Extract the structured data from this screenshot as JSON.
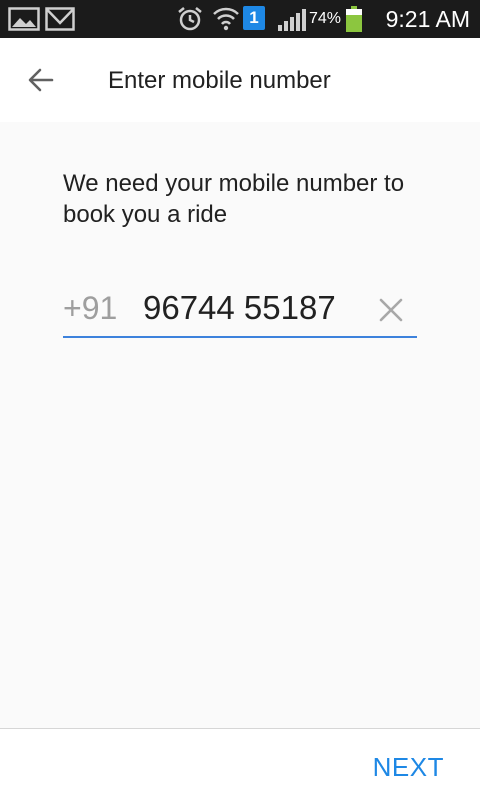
{
  "status_bar": {
    "icons": [
      "gallery-icon",
      "mail-icon",
      "alarm-icon",
      "wifi-icon",
      "notification-badge",
      "signal-icon",
      "battery-icon"
    ],
    "badge_count": "1",
    "battery_percent": "74%",
    "battery_level": 0.74,
    "time": "9:21 AM"
  },
  "header": {
    "back_icon": "arrow-left-icon",
    "title": "Enter mobile number"
  },
  "form": {
    "message": "We need your mobile number to book you a ride",
    "country_code": "+91",
    "phone_value": "96744 55187",
    "clear_icon": "close-icon"
  },
  "footer": {
    "next_label": "NEXT"
  },
  "colors": {
    "accent": "#1e88e5",
    "underline": "#3d82dc",
    "status_bar": "#1b1b1b",
    "battery": "#8cc63f"
  }
}
